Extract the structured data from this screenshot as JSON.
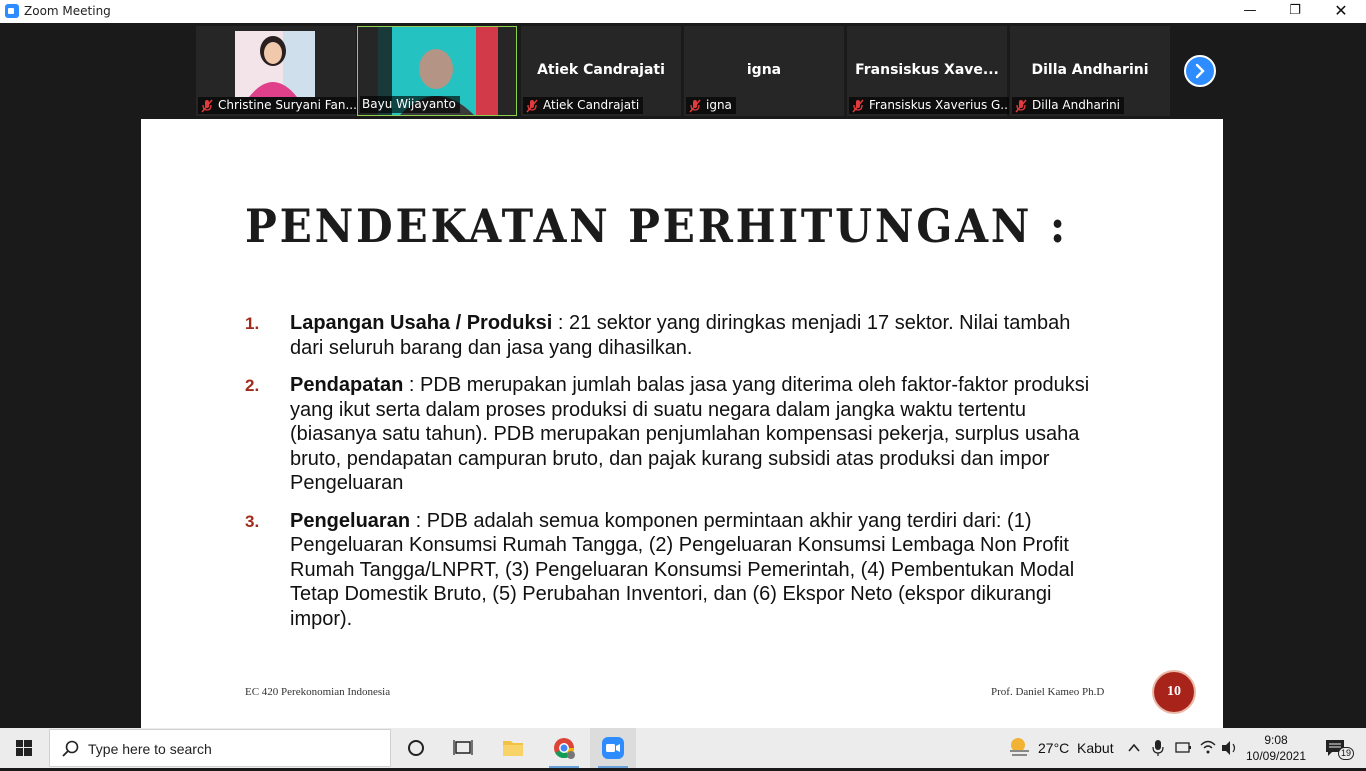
{
  "window": {
    "title": "Zoom Meeting"
  },
  "participants": [
    {
      "center_name": "",
      "label": "Christine Suryani Fan...",
      "has_video": true,
      "active": false
    },
    {
      "center_name": "",
      "label": "Bayu Wijayanto",
      "has_video": true,
      "active": true
    },
    {
      "center_name": "Atiek Candrajati",
      "label": "Atiek Candrajati",
      "has_video": false,
      "active": false
    },
    {
      "center_name": "igna",
      "label": "igna",
      "has_video": false,
      "active": false
    },
    {
      "center_name": "Fransiskus  Xave...",
      "label": "Fransiskus Xaverius G...",
      "has_video": false,
      "active": false
    },
    {
      "center_name": "Dilla Andharini",
      "label": "Dilla Andharini",
      "has_video": false,
      "active": false
    }
  ],
  "slide": {
    "title": "PENDEKATAN PERHITUNGAN :",
    "items": [
      {
        "num": "1.",
        "term": "Lapangan Usaha / Produksi",
        "text": " : 21 sektor yang diringkas menjadi 17 sektor. Nilai tambah dari seluruh barang dan jasa yang dihasilkan."
      },
      {
        "num": "2.",
        "term": "Pendapatan",
        "text": " : PDB merupakan jumlah balas jasa yang diterima oleh faktor-faktor produksi yang ikut serta dalam proses produksi di suatu negara dalam jangka waktu tertentu (biasanya satu tahun). PDB merupakan penjumlahan kompensasi pekerja, surplus usaha bruto, pendapatan campuran bruto, dan pajak kurang subsidi atas produksi dan impor Pengeluaran"
      },
      {
        "num": "3.",
        "term": "Pengeluaran",
        "text": " : PDB adalah semua komponen permintaan akhir yang terdiri dari: (1) Pengeluaran Konsumsi Rumah Tangga, (2) Pengeluaran Konsumsi Lembaga Non Profit Rumah Tangga/LNPRT, (3) Pengeluaran Konsumsi Pemerintah, (4) Pembentukan Modal Tetap Domestik Bruto, (5) Perubahan Inventori, dan (6) Ekspor Neto (ekspor dikurangi impor)."
      }
    ],
    "footer_left": "EC 420 Perekonomian Indonesia",
    "footer_right": "Prof. Daniel Kameo Ph.D",
    "page_number": "10"
  },
  "taskbar": {
    "search_placeholder": "Type here to search",
    "temperature": "27°C",
    "weather": "Kabut",
    "time": "9:08",
    "date": "10/09/2021",
    "notification_count": "19"
  }
}
